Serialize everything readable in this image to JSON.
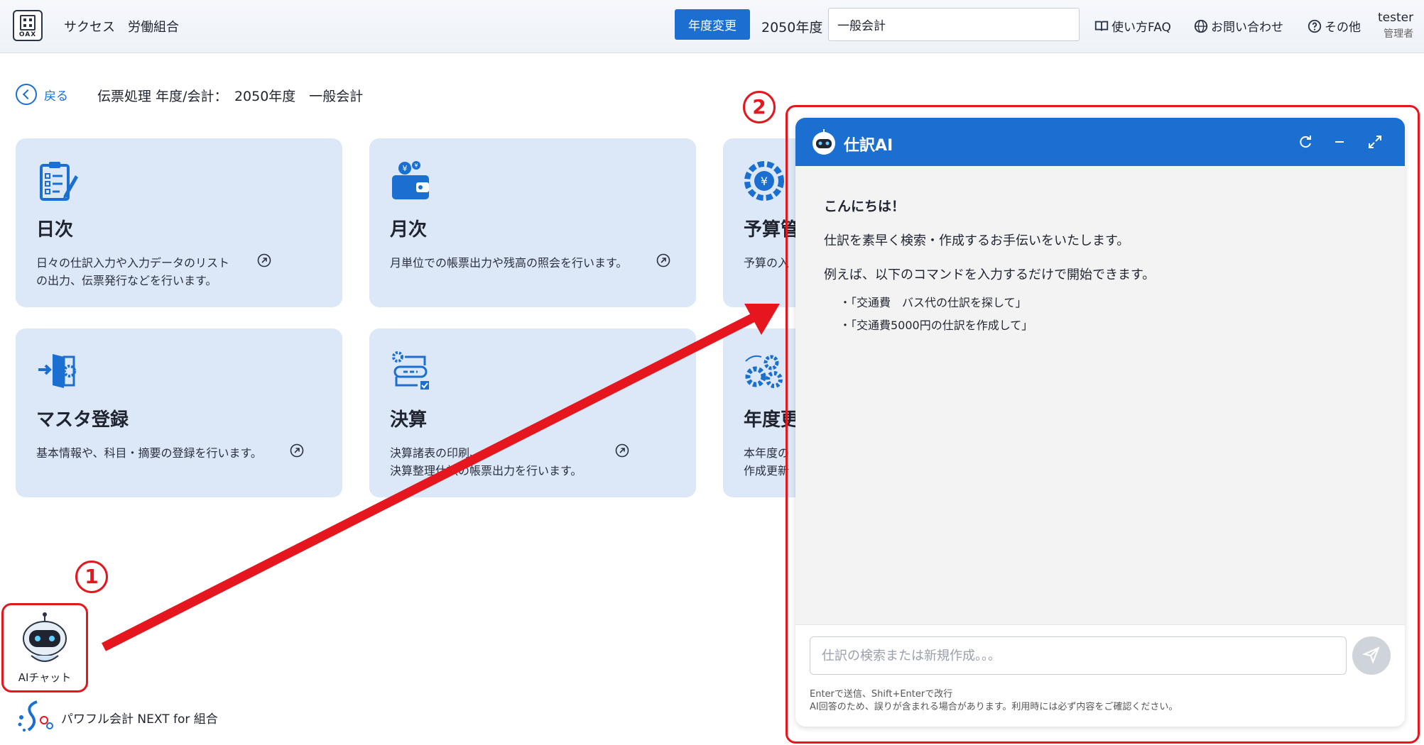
{
  "header": {
    "logo_text": "OAX",
    "org_name": "サクセス　労働組合",
    "year_change_label": "年度変更",
    "fiscal_year": "2050年度",
    "account_value": "一般会計",
    "faq_label": "使い方FAQ",
    "contact_label": "お問い合わせ",
    "other_label": "その他",
    "user_name": "tester",
    "user_role": "管理者"
  },
  "breadcrumb": {
    "back_label": "戻る",
    "title": "伝票処理 年度/会計：　2050年度　一般会計"
  },
  "cards": [
    {
      "title": "日次",
      "desc": "日々の仕訳入力や入力データのリスト\nの出力、伝票発行などを行います。"
    },
    {
      "title": "月次",
      "desc": "月単位での帳票出力や残高の照会を行います。"
    },
    {
      "title": "予算管",
      "desc": "予算の入"
    },
    {
      "title": "マスタ登録",
      "desc": "基本情報や、科目・摘要の登録を行います。"
    },
    {
      "title": "決算",
      "desc": "決算諸表の印刷、\n決算整理仕訳の帳票出力を行います。"
    },
    {
      "title": "年度更",
      "desc": "本年度の\n作成更新"
    }
  ],
  "chat": {
    "title": "仕訳AI",
    "greeting": "こんにちは！",
    "intro": "仕訳を素早く検索・作成するお手伝いをいたします。",
    "example_lead": "例えば、以下のコマンドを入力するだけで開始できます。",
    "commands": [
      "・「交通費　バス代の仕訳を探して」",
      "・「交通費5000円の仕訳を作成して」"
    ],
    "input_placeholder": "仕訳の検索または新規作成。。。",
    "hint": "Enterで送信、Shift+Enterで改行",
    "disclaimer": "AI回答のため、誤りが含まれる場合があります。利用時には必ず内容をご確認ください。"
  },
  "annotations": {
    "step1": "1",
    "step2": "2"
  },
  "launcher": {
    "label": "AIチャット"
  },
  "footer": {
    "product": "パワフル会計 NEXT for 組合"
  },
  "colors": {
    "accent": "#1a6fd1",
    "card_bg": "#dce8f7",
    "annotation_red": "#e5161e"
  }
}
